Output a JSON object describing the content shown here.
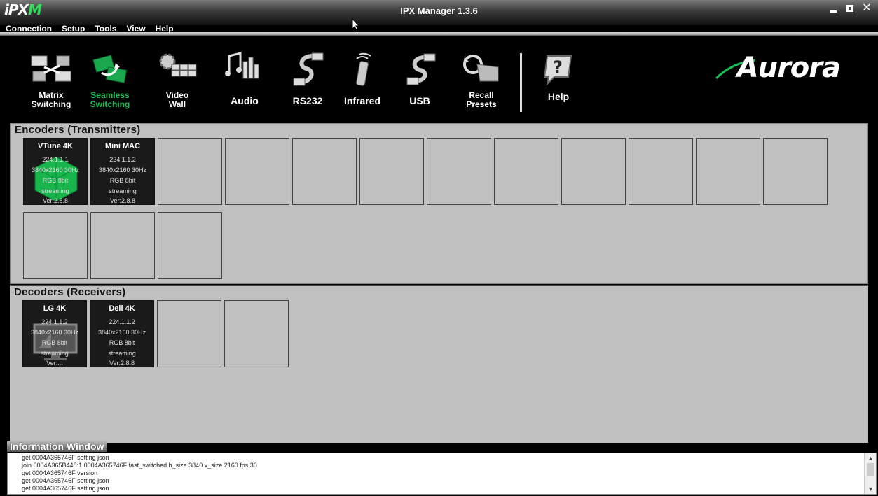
{
  "window": {
    "logo_prefix": "iPX",
    "logo_suffix": "M",
    "title": "IPX Manager 1.3.6"
  },
  "menu": [
    "Connection",
    "Setup",
    "Tools",
    "View",
    "Help"
  ],
  "toolbar": {
    "tools": [
      {
        "line1": "Matrix",
        "line2": "Switching",
        "icon": "matrix-switching-icon",
        "active": false
      },
      {
        "line1": "Seamless",
        "line2": "Switching",
        "icon": "seamless-switching-icon",
        "active": true
      },
      {
        "line1": "Video",
        "line2": "Wall",
        "icon": "video-wall-icon",
        "active": false
      },
      {
        "line1": "Audio",
        "icon": "audio-icon",
        "active": false
      },
      {
        "line1": "RS232",
        "icon": "rs232-icon",
        "active": false
      },
      {
        "line1": "Infrared",
        "icon": "infrared-icon",
        "active": false
      },
      {
        "line1": "USB",
        "icon": "usb-icon",
        "active": false
      },
      {
        "line1": "Recall",
        "line2": "Presets",
        "icon": "recall-presets-icon",
        "active": false
      }
    ],
    "help_label": "Help",
    "brand": "Aurora",
    "accent": "#18c05a"
  },
  "encoders": {
    "title": "Encoders (Transmitters)",
    "devices": [
      {
        "name": "VTune 4K",
        "ip": "224.1.1.1",
        "resolution": "3840x2160 30Hz",
        "color": "RGB 8bit",
        "status": "streaming",
        "version": "Ver:2.8.8"
      },
      {
        "name": "Mini MAC",
        "ip": "224.1.1.2",
        "resolution": "3840x2160 30Hz",
        "color": "RGB 8bit",
        "status": "streaming",
        "version": "Ver:2.8.8"
      }
    ]
  },
  "decoders": {
    "title": "Decoders (Receivers)",
    "devices": [
      {
        "name": "LG 4K",
        "ip": "224.1.1.2",
        "resolution": "3840x2160 30Hz",
        "color": "RGB 8bit",
        "status": "streaming",
        "version": "Ver:..."
      },
      {
        "name": "Dell 4K",
        "ip": "224.1.1.2",
        "resolution": "3840x2160 30Hz",
        "color": "RGB 8bit",
        "status": "streaming",
        "version": "Ver:2.8.8"
      }
    ]
  },
  "info": {
    "title": "Information Window",
    "lines": [
      "get 0004A365746F setting json",
      "join 0004A365B448:1 0004A365746F fast_switched h_size 3840 v_size 2160 fps 30",
      "get 0004A365746F version",
      "get 0004A365746F setting json",
      "get 0004A365746F setting json"
    ]
  }
}
